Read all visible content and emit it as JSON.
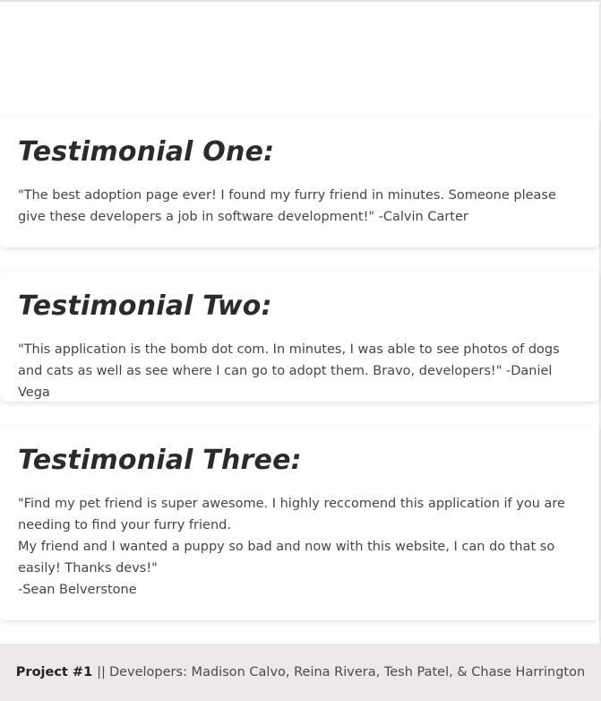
{
  "testimonials": [
    {
      "title": "Testimonial One:",
      "lines": [
        "\"The best adoption page ever! I found my furry friend in minutes. Someone please give these developers a job in software development!\" -Calvin Carter"
      ]
    },
    {
      "title": "Testimonial Two:",
      "lines": [
        "\"This application is the bomb dot com. In minutes, I was able to see photos of dogs and cats as well as see where I can go to adopt them. Bravo, developers!\" -Daniel Vega"
      ]
    },
    {
      "title": "Testimonial Three:",
      "lines": [
        "\"Find my pet friend is super awesome. I highly reccomend this application if you are needing to find your furry friend.",
        "My friend and I wanted a puppy so bad and now with this website, I can do that so easily! Thanks devs!\"",
        "-Sean Belverstone"
      ]
    }
  ],
  "footer": {
    "project_label": "Project #1",
    "separator": "||",
    "developers_text": "Developers: Madison Calvo, Reina Rivera, Tesh Patel, & Chase Harrington"
  },
  "colors": {
    "footer_background": "#ece9e8",
    "heading_text": "#2b2b2b",
    "body_text": "#454545"
  }
}
